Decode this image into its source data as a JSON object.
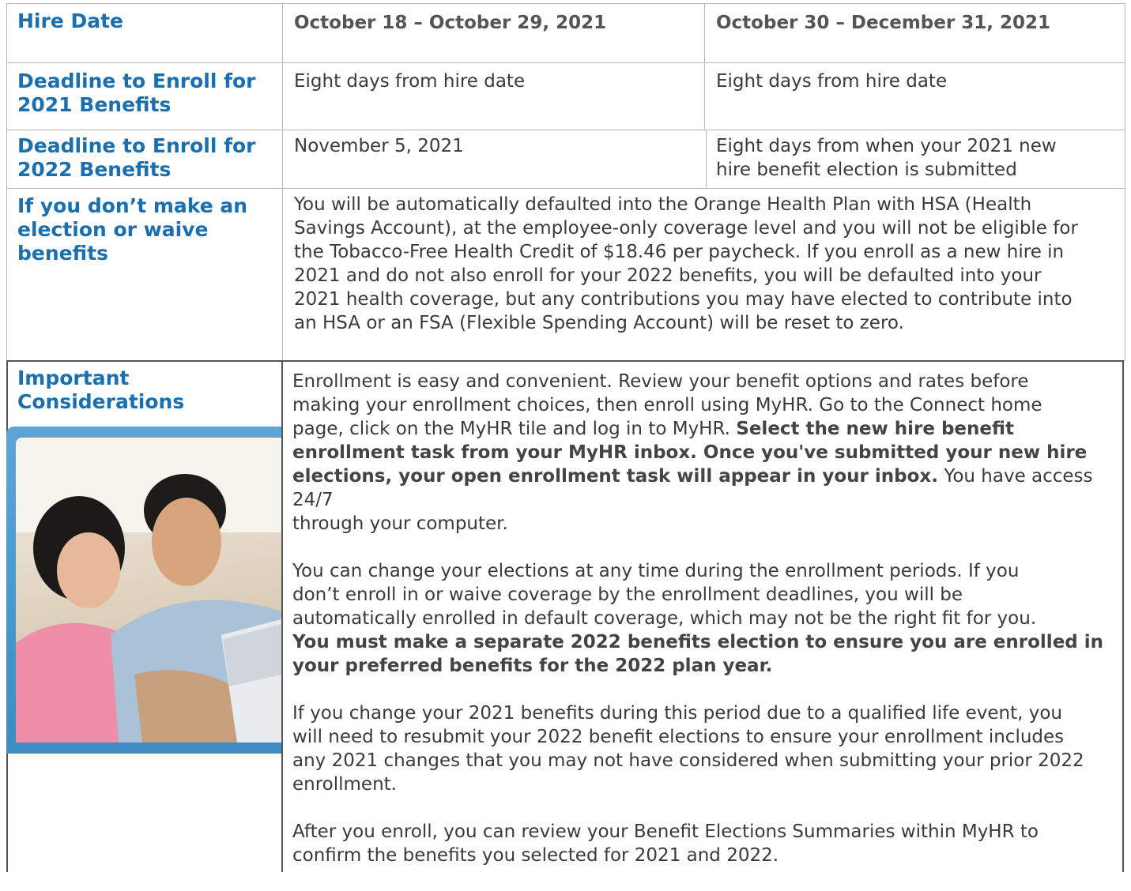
{
  "rows": {
    "hire_date": {
      "label": "Hire Date",
      "col1": "October 18 – October 29, 2021",
      "col2": "October 30 – December 31, 2021"
    },
    "deadline_2021": {
      "label_line1": "Deadline to Enroll for",
      "label_line2": "2021 Benefits",
      "col1": "Eight days from hire date",
      "col2": "Eight days from hire date"
    },
    "deadline_2022": {
      "label_line1": "Deadline to Enroll for",
      "label_line2": "2022 Benefits",
      "col1": "November 5, 2021",
      "col2_line1": "Eight days from when your 2021 new",
      "col2_line2": "hire benefit election is submitted"
    },
    "no_election": {
      "label_line1": "If you don’t make an",
      "label_line2": "election or waive",
      "label_line3": "benefits",
      "lines": [
        "You will be automatically defaulted into the Orange Health Plan with HSA (Health",
        "Savings Account), at the employee-only coverage level and you will not be eligible for",
        "the Tobacco-Free Health Credit of $18.46 per paycheck. If you enroll as a new hire in",
        "2021 and do not also enroll for your 2022 benefits, you will be defaulted into your",
        "2021 health coverage, but any contributions you may have elected to contribute into",
        "an HSA or an FSA (Flexible Spending Account) will be reset to zero."
      ]
    },
    "considerations": {
      "label_line1": "Important",
      "label_line2": "Considerations",
      "p1_lines": [
        "Enrollment is easy and convenient. Review your benefit options and rates before",
        "making your enrollment choices, then enroll using MyHR. Go to the Connect home"
      ],
      "p1_line3_plain": "page, click on the MyHR tile and log in to MyHR. ",
      "p1_line3_bold": "Select the new hire benefit",
      "p1_bold_lines": [
        "enrollment task from your MyHR inbox. Once you've submitted your new hire"
      ],
      "p1_line5_bold": "elections, your open enrollment task will appear in your inbox.",
      "p1_line5_plain": " You have access 24/7",
      "p1_line6": "through your computer.",
      "p2_lines": [
        "You can change your elections at any time during the enrollment periods. If you",
        "don’t enroll in or waive coverage by the enrollment deadlines, you will be",
        "automatically enrolled in default coverage, which may not be the right fit for you."
      ],
      "p2_bold_lines": [
        "You must make a separate 2022 benefits election to ensure you are enrolled in",
        "your preferred benefits for the 2022 plan year."
      ],
      "p3_lines": [
        "If you change your 2021 benefits during this period due to a qualified life event, you",
        "will need to resubmit your 2022 benefit elections to ensure your enrollment includes",
        "any 2021 changes that you may not have considered when submitting your prior 2022",
        "enrollment."
      ],
      "p4_lines": [
        "After you enroll, you can review your Benefit Elections Summaries within MyHR to",
        "confirm the benefits you selected for 2021 and 2022."
      ]
    }
  },
  "colors": {
    "heading": "#1a6fae",
    "border": "#b8b8b8",
    "photo_frame": "#4a95cc"
  }
}
